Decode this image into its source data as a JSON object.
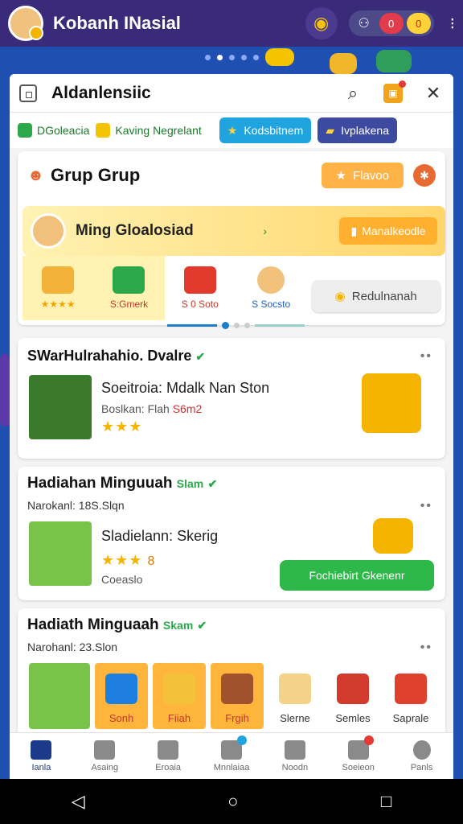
{
  "app": {
    "title": "Kobanh INasial"
  },
  "topbar": {
    "pill_red": "0",
    "pill_yellow": "0"
  },
  "panel": {
    "title": "Aldanlensiic"
  },
  "filters": [
    {
      "label": "DGoleacia",
      "color": "#2aa84a"
    },
    {
      "label": "Kaving Negrelant",
      "color": "#f5c400"
    }
  ],
  "filter_buttons": [
    {
      "label": "Kodsbitnem",
      "bg": "#1fa4e0"
    },
    {
      "label": "Ivplakena",
      "bg": "#3c4aa0"
    }
  ],
  "group": {
    "title": "Grup Grup",
    "button": "Flavoo",
    "member_name": "Ming Gloalosiad",
    "member_button": "Manalkeodle",
    "rewards": [
      {
        "label": "★★★★",
        "style": "gold"
      },
      {
        "label": "S:Gmerk",
        "style": "red"
      },
      {
        "label": "S 0 Soto",
        "style": "red"
      },
      {
        "label": "S Socsto",
        "style": "blue"
      }
    ],
    "side_button": "Redulnanah"
  },
  "card1": {
    "title": "SWarHulrahahio. Dvalre",
    "row_text": "Soeitroia: Mdalk Nan Ston",
    "row_sub_a": "Boslkan: Flah",
    "row_sub_b": "S6m2",
    "stars": "★★★"
  },
  "card2": {
    "title": "Hadiahan Minguuah",
    "badge": "Slam",
    "sub": "Narokanl: 18S.Slqn",
    "row_text": "Sladielann: Skerig",
    "stars": "★★★",
    "stars_num": "8",
    "row_sub": "Coeaslo",
    "button": "Fochiebirt Gkenenr"
  },
  "card3": {
    "title": "Hadiath Minguaah",
    "badge": "Skam",
    "sub": "Narohanl: 23.Slon",
    "items": [
      {
        "label": "",
        "style": "plain"
      },
      {
        "label": "Sonh",
        "style": "org"
      },
      {
        "label": "Fiiah",
        "style": "org"
      },
      {
        "label": "Frgih",
        "style": "org"
      },
      {
        "label": "Slerne",
        "style": "plain"
      },
      {
        "label": "Semles",
        "style": "plain"
      },
      {
        "label": "Saprale",
        "style": "plain"
      }
    ]
  },
  "nav": [
    {
      "label": "Ianla",
      "active": true
    },
    {
      "label": "Asaing",
      "active": false
    },
    {
      "label": "Eroaia",
      "active": false
    },
    {
      "label": "Mnnlaiaa",
      "active": false
    },
    {
      "label": "Noodn",
      "active": false
    },
    {
      "label": "Soeieon",
      "active": false
    },
    {
      "label": "Panls",
      "active": false
    }
  ],
  "system": {
    "back": "◁",
    "home": "○",
    "recent": "□"
  }
}
